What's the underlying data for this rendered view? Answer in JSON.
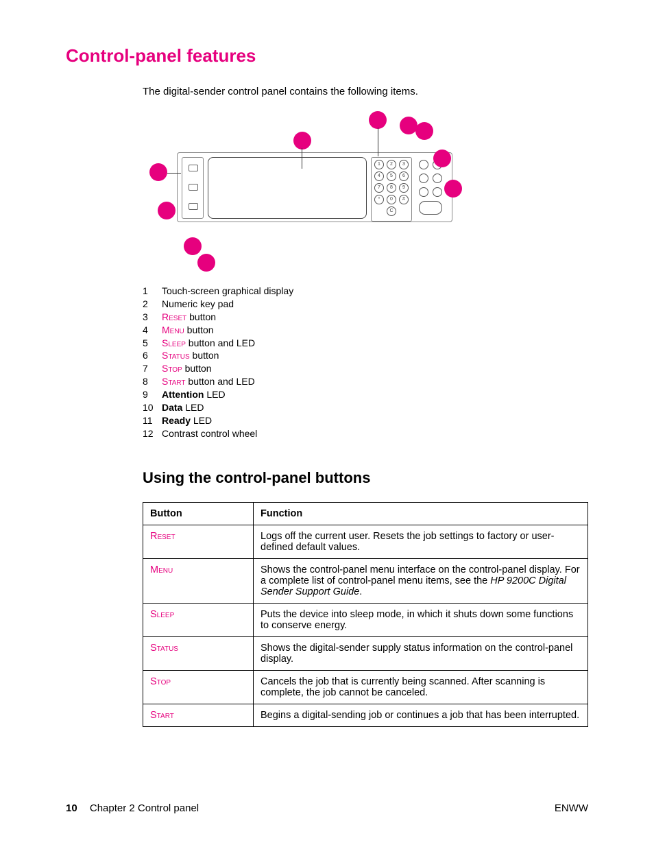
{
  "title": "Control-panel features",
  "intro": "The digital-sender control panel contains the following items.",
  "legend": [
    {
      "num": "1",
      "pink": "",
      "plain": "Touch-screen graphical display"
    },
    {
      "num": "2",
      "pink": "",
      "plain": "Numeric key pad"
    },
    {
      "num": "3",
      "pink": "Reset",
      "plain": " button"
    },
    {
      "num": "4",
      "pink": "Menu",
      "plain": " button"
    },
    {
      "num": "5",
      "pink": "Sleep",
      "plain": " button and LED"
    },
    {
      "num": "6",
      "pink": "Status",
      "plain": " button"
    },
    {
      "num": "7",
      "pink": "Stop",
      "plain": " button"
    },
    {
      "num": "8",
      "pink": "Start",
      "plain": " button and LED"
    },
    {
      "num": "9",
      "bold": "Attention",
      "plain": " LED"
    },
    {
      "num": "10",
      "bold": "Data",
      "plain": " LED"
    },
    {
      "num": "11",
      "bold": "Ready",
      "plain": " LED"
    },
    {
      "num": "12",
      "pink": "",
      "plain": "Contrast control wheel"
    }
  ],
  "sub": "Using the control-panel buttons",
  "table": {
    "headers": {
      "c1": "Button",
      "c2": "Function"
    },
    "rows": [
      {
        "btn": "Reset",
        "desc": "Logs off the current user. Resets the job settings to factory or user-defined default values."
      },
      {
        "btn": "Menu",
        "desc_pre": "Shows the control-panel menu interface on the control-panel display. For a complete list of control-panel menu items, see the ",
        "desc_ital": "HP 9200C Digital Sender Support Guide",
        "desc_post": "."
      },
      {
        "btn": "Sleep",
        "desc": "Puts the device into sleep mode, in which it shuts down some functions to conserve energy."
      },
      {
        "btn": "Status",
        "desc": "Shows the digital-sender supply status information on the control-panel display."
      },
      {
        "btn": "Stop",
        "desc": "Cancels the job that is currently being scanned. After scanning is complete, the job cannot be canceled."
      },
      {
        "btn": "Start",
        "desc": "Begins a digital-sending job or continues a job that has been interrupted."
      }
    ]
  },
  "footer": {
    "page": "10",
    "chapter": "Chapter 2  Control panel",
    "right": "ENWW"
  },
  "keypad": [
    [
      "1",
      "2",
      "3"
    ],
    [
      "4",
      "5",
      "6"
    ],
    [
      "7",
      "8",
      "9"
    ],
    [
      "*",
      "0",
      "#"
    ],
    [
      "",
      "C",
      ""
    ]
  ]
}
